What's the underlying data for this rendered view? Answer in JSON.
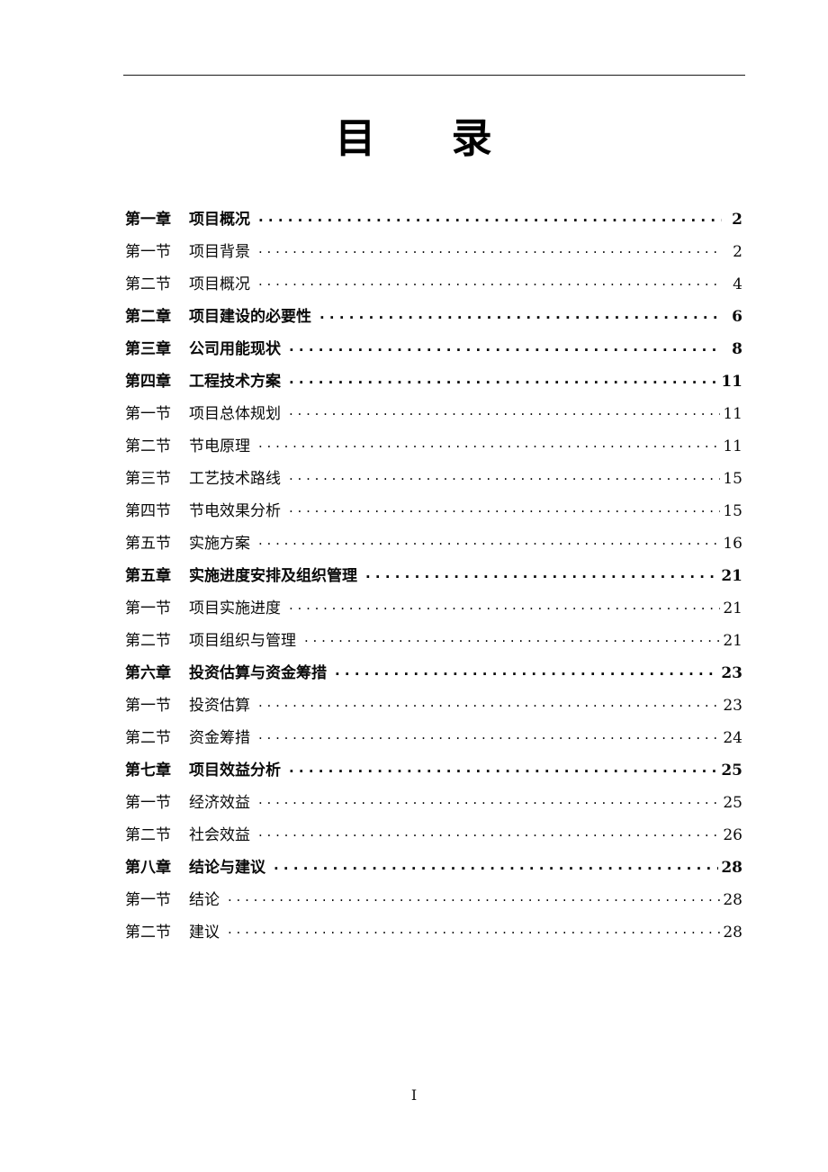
{
  "document": {
    "title": "目     录",
    "footer_page_label": "I",
    "text_color": "#0a0a0a",
    "rule_color": "#1a1a1a",
    "background_color": "#ffffff"
  },
  "toc": {
    "entries": [
      {
        "level": "chapter",
        "label": "第一章",
        "title": "项目概况",
        "page": "2"
      },
      {
        "level": "section",
        "label": "第一节",
        "title": "项目背景",
        "page": "2"
      },
      {
        "level": "section",
        "label": "第二节",
        "title": "项目概况",
        "page": "4"
      },
      {
        "level": "chapter",
        "label": "第二章",
        "title": "项目建设的必要性",
        "page": "6"
      },
      {
        "level": "chapter",
        "label": "第三章",
        "title": "公司用能现状",
        "page": "8"
      },
      {
        "level": "chapter",
        "label": "第四章",
        "title": "工程技术方案",
        "page": "11"
      },
      {
        "level": "section",
        "label": "第一节",
        "title": "项目总体规划",
        "page": "11"
      },
      {
        "level": "section",
        "label": "第二节",
        "title": "节电原理",
        "page": "11"
      },
      {
        "level": "section",
        "label": "第三节",
        "title": "工艺技术路线",
        "page": "15"
      },
      {
        "level": "section",
        "label": "第四节",
        "title": "节电效果分析",
        "page": "15"
      },
      {
        "level": "section",
        "label": "第五节",
        "title": "实施方案",
        "page": "16"
      },
      {
        "level": "chapter",
        "label": "第五章",
        "title": "实施进度安排及组织管理",
        "page": "21"
      },
      {
        "level": "section",
        "label": "第一节",
        "title": "项目实施进度",
        "page": "21"
      },
      {
        "level": "section",
        "label": "第二节",
        "title": "项目组织与管理",
        "page": "21"
      },
      {
        "level": "chapter",
        "label": "第六章",
        "title": "投资估算与资金筹措",
        "page": "23"
      },
      {
        "level": "section",
        "label": "第一节",
        "title": "投资估算",
        "page": "23"
      },
      {
        "level": "section",
        "label": "第二节",
        "title": "资金筹措",
        "page": "24"
      },
      {
        "level": "chapter",
        "label": "第七章",
        "title": "项目效益分析",
        "page": "25"
      },
      {
        "level": "section",
        "label": "第一节",
        "title": "经济效益",
        "page": "25"
      },
      {
        "level": "section",
        "label": "第二节",
        "title": "社会效益",
        "page": "26"
      },
      {
        "level": "chapter",
        "label": "第八章",
        "title": "结论与建议",
        "page": "28"
      },
      {
        "level": "section",
        "label": "第一节",
        "title": "结论",
        "page": "28"
      },
      {
        "level": "section",
        "label": "第二节",
        "title": "建议",
        "page": "28"
      }
    ]
  }
}
